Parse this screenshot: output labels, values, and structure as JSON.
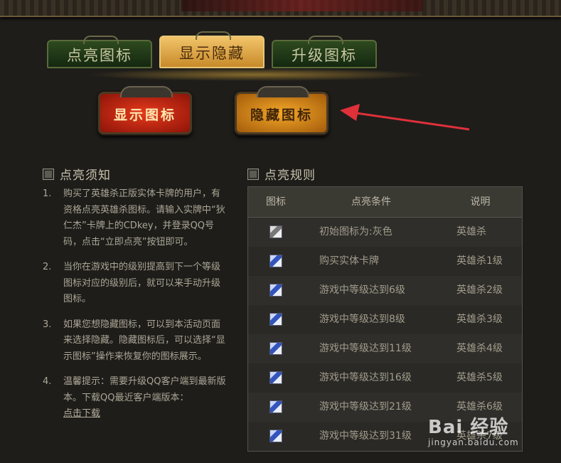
{
  "tabs": [
    {
      "label": "点亮图标",
      "active": false
    },
    {
      "label": "显示隐藏",
      "active": true
    },
    {
      "label": "升级图标",
      "active": false
    }
  ],
  "buttons": {
    "show_icon": "显示图标",
    "hide_icon": "隐藏图标"
  },
  "notice": {
    "title": "点亮须知",
    "items": [
      {
        "num": "1.",
        "text": "购买了英雄杀正版实体卡牌的用户，有资格点亮英雄杀图标。请输入实牌中“狄仁杰”卡牌上的CDkey，并登录QQ号码，点击“立即点亮”按钮即可。"
      },
      {
        "num": "2.",
        "text": "当你在游戏中的级别提高到下一个等级图标对应的级别后，就可以来手动升级图标。"
      },
      {
        "num": "3.",
        "text": "如果您想隐藏图标，可以到本活动页面来选择隐藏。隐藏图标后，可以选择“显示图标”操作来恢复你的图标展示。"
      },
      {
        "num": "4.",
        "text": "温馨提示：需要升级QQ客户端到最新版本。下载QQ最近客户端版本：",
        "link": "点击下载"
      }
    ]
  },
  "rules": {
    "title": "点亮规则",
    "headers": [
      "图标",
      "点亮条件",
      "说明"
    ],
    "rows": [
      {
        "condition": "初始图标为:灰色",
        "desc": "英雄杀",
        "icon": "gray-hero-icon"
      },
      {
        "condition": "购买实体卡牌",
        "desc": "英雄杀1级",
        "icon": "hero-level-icon"
      },
      {
        "condition": "游戏中等级达到6级",
        "desc": "英雄杀2级",
        "icon": "hero-level-icon"
      },
      {
        "condition": "游戏中等级达到8级",
        "desc": "英雄杀3级",
        "icon": "hero-level-icon"
      },
      {
        "condition": "游戏中等级达到11级",
        "desc": "英雄杀4级",
        "icon": "hero-level-icon"
      },
      {
        "condition": "游戏中等级达到16级",
        "desc": "英雄杀5级",
        "icon": "hero-level-icon"
      },
      {
        "condition": "游戏中等级达到21级",
        "desc": "英雄杀6级",
        "icon": "hero-level-icon"
      },
      {
        "condition": "游戏中等级达到31级",
        "desc": "英雄杀7级",
        "icon": "hero-level-icon"
      }
    ]
  },
  "watermark": {
    "line1": "Bai 经验",
    "line2": "jingyan.baidu.com"
  },
  "colors": {
    "accent_gold": "#e7b54a",
    "accent_red": "#c8210f",
    "arrow": "#e0303a"
  }
}
